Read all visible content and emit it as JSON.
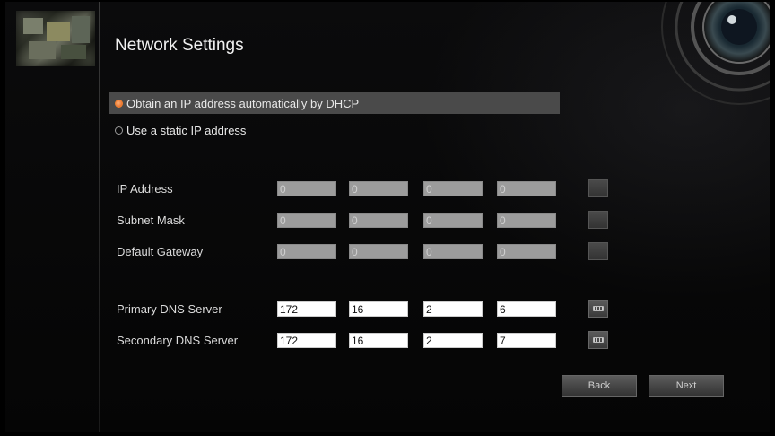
{
  "page": {
    "title": "Network Settings"
  },
  "ip_mode": {
    "options": [
      {
        "label": "Obtain an IP address automatically by DHCP",
        "selected": true
      },
      {
        "label": "Use a static IP address",
        "selected": false
      }
    ]
  },
  "fields": {
    "ip_address": {
      "label": "IP Address",
      "octets": [
        "0",
        "0",
        "0",
        "0"
      ],
      "enabled": false
    },
    "subnet_mask": {
      "label": "Subnet Mask",
      "octets": [
        "0",
        "0",
        "0",
        "0"
      ],
      "enabled": false
    },
    "default_gateway": {
      "label": "Default Gateway",
      "octets": [
        "0",
        "0",
        "0",
        "0"
      ],
      "enabled": false
    },
    "primary_dns": {
      "label": "Primary DNS Server",
      "octets": [
        "172",
        "16",
        "2",
        "6"
      ],
      "enabled": true
    },
    "secondary_dns": {
      "label": "Secondary DNS Server",
      "octets": [
        "172",
        "16",
        "2",
        "7"
      ],
      "enabled": true
    }
  },
  "buttons": {
    "back": "Back",
    "next": "Next"
  },
  "colors": {
    "radio_selected": "#e05a14",
    "selected_row_bg": "#4a4a4a"
  },
  "icons": [
    "keyboard-icon",
    "radio-selected-icon",
    "radio-unselected-icon",
    "camera-lens-icon"
  ]
}
